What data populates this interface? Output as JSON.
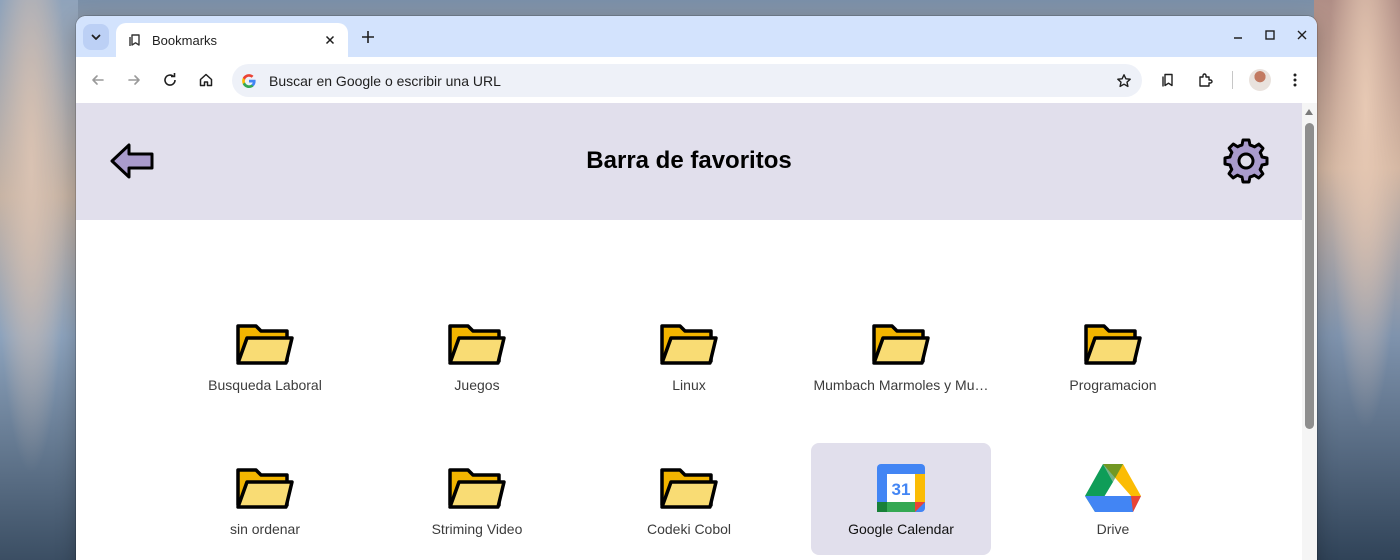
{
  "browser": {
    "tab": {
      "title": "Bookmarks"
    },
    "omnibox": {
      "placeholder": "Buscar en Google o escribir una URL"
    }
  },
  "page": {
    "title": "Barra de favoritos"
  },
  "colors": {
    "header_band": "#e1dfec",
    "folder_fill": "#f9dc74",
    "folder_back": "#f3b500",
    "tabstrip": "#d3e3fd"
  },
  "bookmarks": [
    {
      "label": "Busqueda Laboral",
      "type": "folder"
    },
    {
      "label": "Juegos",
      "type": "folder"
    },
    {
      "label": "Linux",
      "type": "folder"
    },
    {
      "label": "Mumbach Marmoles y Mu…",
      "type": "folder"
    },
    {
      "label": "Programacion",
      "type": "folder"
    },
    {
      "label": "sin ordenar",
      "type": "folder"
    },
    {
      "label": "Striming Video",
      "type": "folder"
    },
    {
      "label": "Codeki Cobol",
      "type": "folder"
    },
    {
      "label": "Google Calendar",
      "type": "link",
      "icon": "google-calendar-icon",
      "icon_text": "31",
      "selected": true
    },
    {
      "label": "Drive",
      "type": "link",
      "icon": "google-drive-icon"
    }
  ]
}
